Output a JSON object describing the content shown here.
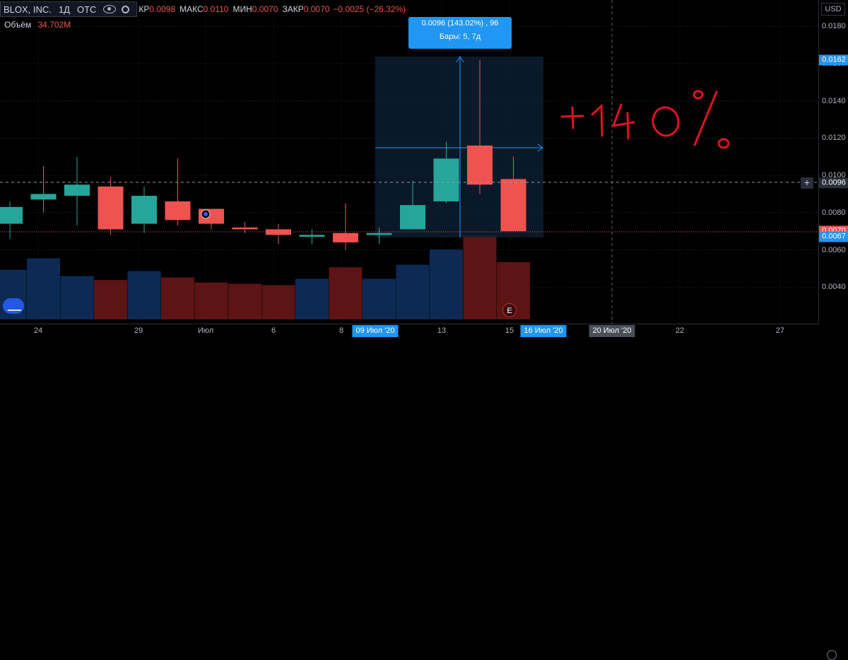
{
  "legend": {
    "symbol": "BLOX, INC.",
    "interval": "1Д",
    "exchange": "OTC",
    "open_label": "КР",
    "open_value": "0.0098",
    "high_label": "МАКС",
    "high_value": "0.0110",
    "low_label": "МИН",
    "low_value": "0.0070",
    "close_label": "ЗАКР",
    "close_value": "0.0070",
    "change": "−0.0025 (−26.32%)"
  },
  "volume": {
    "label": "Объём",
    "value": "34.702M"
  },
  "currency": "USD",
  "tooltip": {
    "line1": "0.0096 (143.02%) , 96",
    "line2": "Бары: 5, 7д"
  },
  "annotation_text": "+140 %",
  "earnings_badge": "E",
  "price_axis": {
    "ticks": [
      "0.0180",
      "0.0160",
      "0.0140",
      "0.0120",
      "0.0100",
      "0.0080",
      "0.0060",
      "0.0040"
    ],
    "tags": [
      {
        "text": "0.0162",
        "color": "#2196f3"
      },
      {
        "text": "0.0096",
        "color": "#2a2e39"
      },
      {
        "text": "0.0070",
        "color": "#ef5350"
      },
      {
        "text": "0.0067",
        "color": "#2196f3"
      }
    ]
  },
  "time_axis": {
    "ticks": [
      "24",
      "29",
      "Июл",
      "6",
      "8",
      "13",
      "15",
      "22",
      "27"
    ],
    "tags": [
      {
        "text": "09 Июл '20",
        "color": "#2196f3"
      },
      {
        "text": "16 Июл '20",
        "color": "#2196f3"
      },
      {
        "text": "20 Июл '20",
        "color": "#4a4e59"
      }
    ]
  },
  "colors": {
    "up": "#26a69a",
    "down": "#ef5350",
    "vol_up": "#0d2a55",
    "vol_down": "#5c1414",
    "accent": "#2196f3"
  },
  "chart_data": {
    "type": "candlestick",
    "candles": [
      {
        "o": 0.0074,
        "h": 0.0086,
        "l": 0.0066,
        "c": 0.0083
      },
      {
        "o": 0.0087,
        "h": 0.0105,
        "l": 0.008,
        "c": 0.009
      },
      {
        "o": 0.0089,
        "h": 0.011,
        "l": 0.0073,
        "c": 0.0095
      },
      {
        "o": 0.0094,
        "h": 0.0099,
        "l": 0.0068,
        "c": 0.0071
      },
      {
        "o": 0.0074,
        "h": 0.0094,
        "l": 0.0069,
        "c": 0.0089
      },
      {
        "o": 0.0086,
        "h": 0.0109,
        "l": 0.0073,
        "c": 0.0076
      },
      {
        "o": 0.0082,
        "h": 0.0082,
        "l": 0.0071,
        "c": 0.0074
      },
      {
        "o": 0.0072,
        "h": 0.0075,
        "l": 0.0069,
        "c": 0.0071
      },
      {
        "o": 0.0071,
        "h": 0.0074,
        "l": 0.0063,
        "c": 0.0068
      },
      {
        "o": 0.0067,
        "h": 0.0071,
        "l": 0.0063,
        "c": 0.0068
      },
      {
        "o": 0.0069,
        "h": 0.0085,
        "l": 0.006,
        "c": 0.0064
      },
      {
        "o": 0.0068,
        "h": 0.0072,
        "l": 0.0063,
        "c": 0.0069
      },
      {
        "o": 0.0071,
        "h": 0.0097,
        "l": 0.0071,
        "c": 0.0084
      },
      {
        "o": 0.0086,
        "h": 0.0118,
        "l": 0.0085,
        "c": 0.0109
      },
      {
        "o": 0.0116,
        "h": 0.0162,
        "l": 0.009,
        "c": 0.0095
      },
      {
        "o": 0.0098,
        "h": 0.011,
        "l": 0.007,
        "c": 0.007
      }
    ],
    "volume_values": [
      0.39,
      0.48,
      0.34,
      0.31,
      0.38,
      0.33,
      0.29,
      0.28,
      0.27,
      0.32,
      0.41,
      0.32,
      0.43,
      0.55,
      0.66,
      0.45
    ]
  }
}
